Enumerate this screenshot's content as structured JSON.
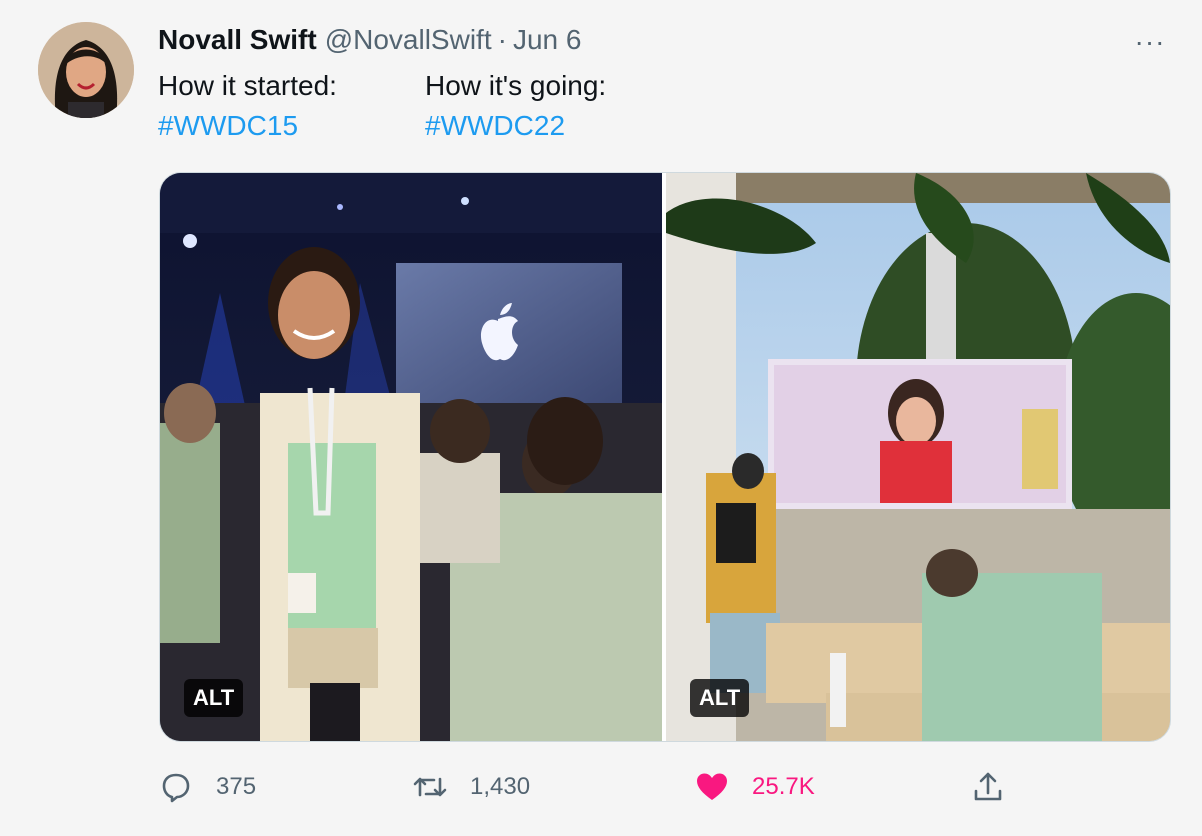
{
  "tweet": {
    "author_name": "Novall Swift",
    "handle": "@NovallSwift",
    "separator": "·",
    "date": "Jun 6",
    "more_label": "···",
    "left_caption": "How it started:",
    "left_hashtag": "#WWDC15",
    "right_caption": "How it's going:",
    "right_hashtag": "#WWDC22"
  },
  "media": {
    "left_alt_badge": "ALT",
    "right_alt_badge": "ALT"
  },
  "actions": {
    "reply_count": "375",
    "retweet_count": "1,430",
    "like_count": "25.7K"
  },
  "icons": {
    "reply": "reply-icon",
    "retweet": "retweet-icon",
    "like": "heart-icon",
    "share": "share-icon",
    "more": "more-dots-icon"
  },
  "colors": {
    "link": "#1d9bf0",
    "like": "#f91880",
    "secondary_text": "#536471"
  }
}
